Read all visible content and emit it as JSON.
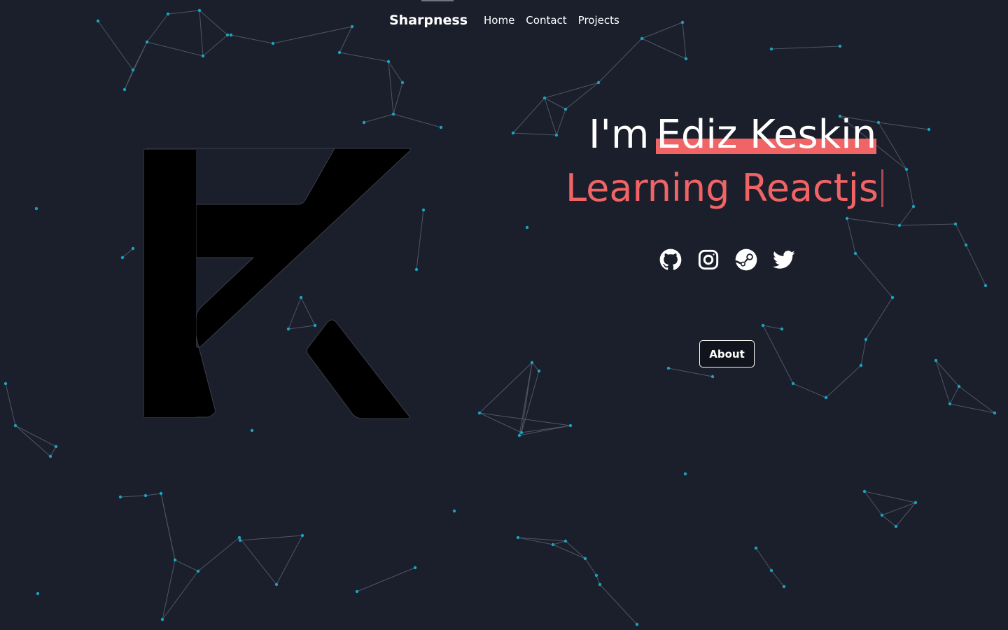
{
  "nav": {
    "brand": "Sharpness",
    "links": [
      {
        "label": "Home"
      },
      {
        "label": "Contact"
      },
      {
        "label": "Projects"
      }
    ]
  },
  "hero": {
    "prefix": "I'm",
    "name": "Ediz Keskin",
    "typed_text": "Learning Reactjs"
  },
  "social": [
    {
      "icon": "github-icon"
    },
    {
      "icon": "instagram-icon"
    },
    {
      "icon": "steam-icon"
    },
    {
      "icon": "twitter-icon"
    }
  ],
  "about_button": {
    "label": "About"
  },
  "colors": {
    "background": "#1b1f2b",
    "accent": "#f06466",
    "particle": "#1aa3c0",
    "text": "#ffffff"
  }
}
